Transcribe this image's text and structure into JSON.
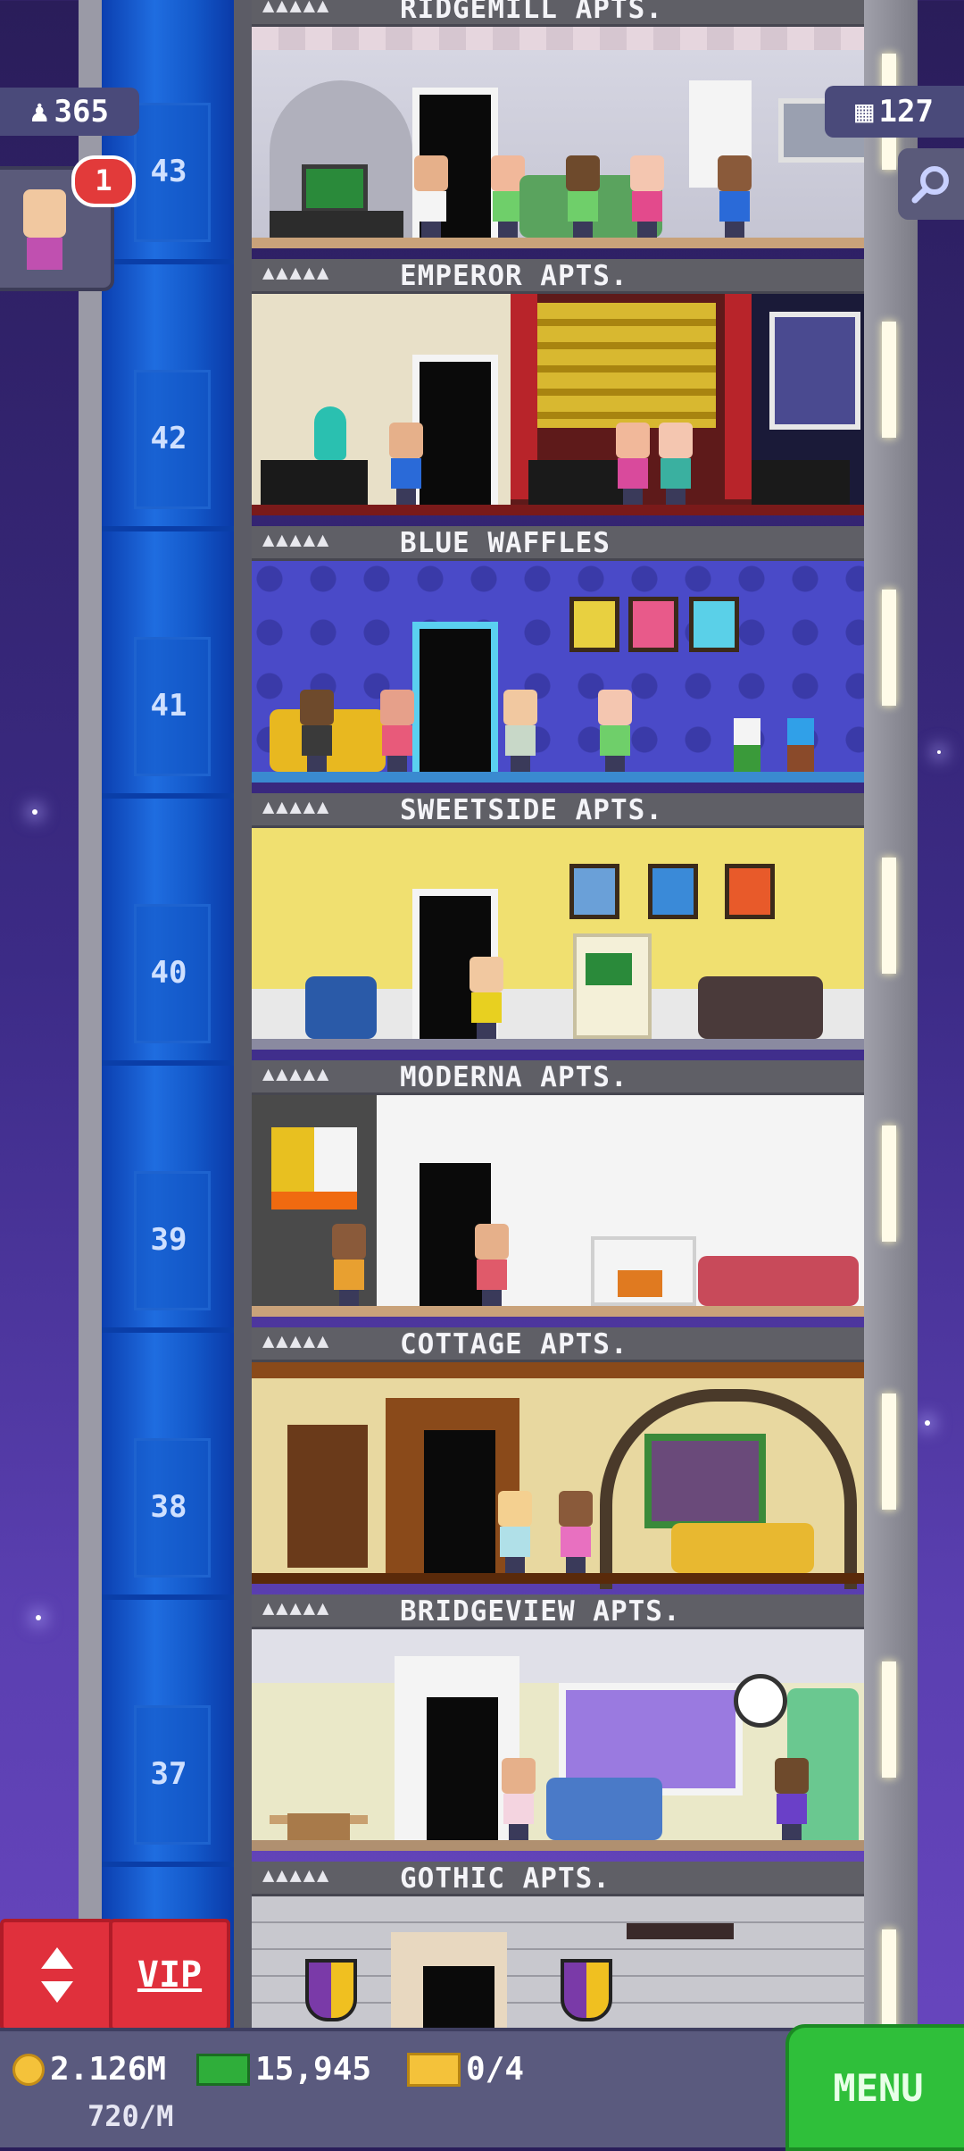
{
  "hud": {
    "population": "365",
    "visitor_notifications": "1",
    "floor_count": "127"
  },
  "floors": [
    {
      "number": "43",
      "name": "RIDGEMILL APTS.",
      "stars": "▲▲▲▲▲"
    },
    {
      "number": "42",
      "name": "EMPEROR APTS.",
      "stars": "▲▲▲▲▲"
    },
    {
      "number": "41",
      "name": "BLUE WAFFLES",
      "stars": "▲▲▲▲▲"
    },
    {
      "number": "40",
      "name": "SWEETSIDE APTS.",
      "stars": "▲▲▲▲▲"
    },
    {
      "number": "39",
      "name": "MODERNA APTS.",
      "stars": "▲▲▲▲▲"
    },
    {
      "number": "38",
      "name": "COTTAGE APTS.",
      "stars": "▲▲▲▲▲"
    },
    {
      "number": "37",
      "name": "BRIDGEVIEW APTS.",
      "stars": "▲▲▲▲▲"
    },
    {
      "number": "",
      "name": "GOTHIC APTS.",
      "stars": "▲▲▲▲▲"
    }
  ],
  "buttons": {
    "vip_label": "VIP",
    "menu_label": "MENU"
  },
  "stats": {
    "coins": "2.126M",
    "bux": "15,945",
    "tickets": "0/4",
    "coin_rate": "720/M"
  },
  "colors": {
    "accent_red": "#e0303c",
    "menu_green": "#2fbf3a",
    "elevator_blue": "#1358c9"
  }
}
